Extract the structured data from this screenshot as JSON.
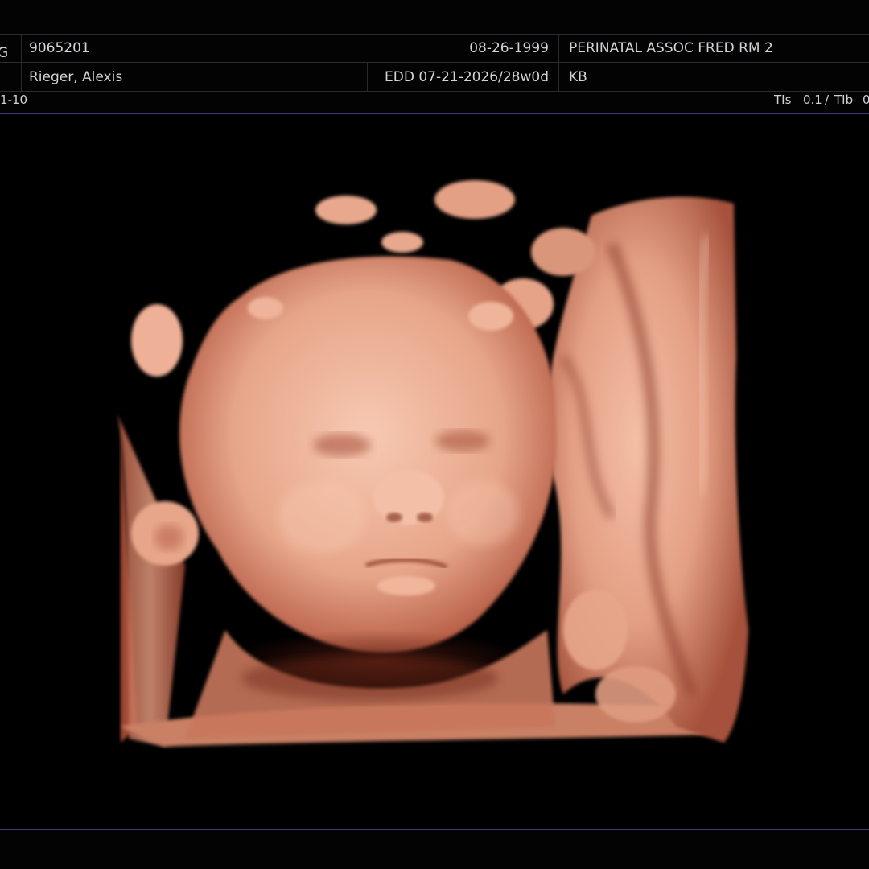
{
  "patient": {
    "id": "9065201",
    "name": "Rieger, Alexis",
    "dob": "08-26-1999",
    "edd_ga": "EDD 07-21-2026/28w0d",
    "location": "PERINATAL ASSOC FRED RM 2",
    "operator": "KB"
  },
  "status_bar": {
    "left_text": "1-10",
    "tis_label": "TIs",
    "tis_value": "0.1",
    "separator": "/",
    "tib_label": "TIb",
    "tib_value": "0"
  },
  "edge_glyph": "G",
  "colors": {
    "background": "#000000",
    "accent_line": "#3d3a78",
    "render_tissue": "#e8a58a",
    "render_shadow": "#5a1e14"
  },
  "viewport": {
    "icon": "3d-rendered-fetal-face"
  }
}
